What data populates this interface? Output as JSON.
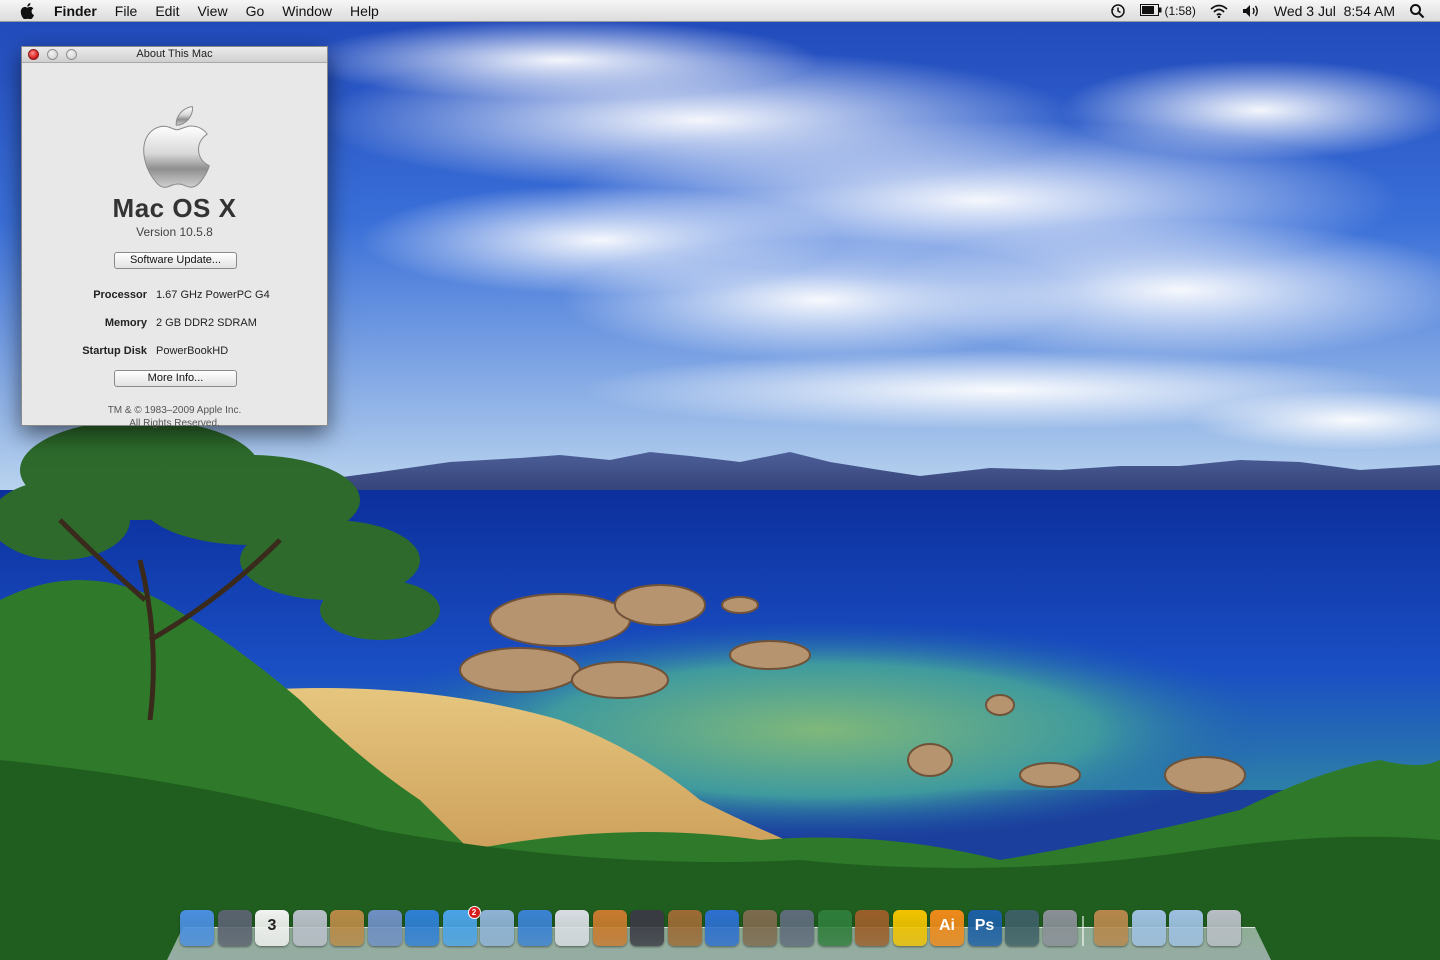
{
  "menubar": {
    "app_name": "Finder",
    "items": [
      "File",
      "Edit",
      "View",
      "Go",
      "Window",
      "Help"
    ],
    "battery_time": "(1:58)",
    "clock": "Wed 3 Jul  8:54 AM"
  },
  "about_window": {
    "title": "About This Mac",
    "os_name": "Mac OS X",
    "version": "Version 10.5.8",
    "software_update_button": "Software Update...",
    "specs": {
      "processor_label": "Processor",
      "processor_value": "1.67 GHz PowerPC G4",
      "memory_label": "Memory",
      "memory_value": "2 GB DDR2 SDRAM",
      "disk_label": "Startup Disk",
      "disk_value": "PowerBookHD"
    },
    "more_info_button": "More Info...",
    "copyright_line1": "TM & © 1983–2009 Apple Inc.",
    "copyright_line2": "All Rights Reserved."
  },
  "dock": {
    "calendar_date": "3",
    "ichat_badge": "2",
    "illustrator_label": "Ai",
    "photoshop_label": "Ps",
    "items": [
      {
        "name": "finder-icon",
        "color": "#4a8ee0"
      },
      {
        "name": "dashboard-icon",
        "color": "#5a6270"
      },
      {
        "name": "ical-icon",
        "color": "#f2f2f2"
      },
      {
        "name": "preview-icon",
        "color": "#b9bfc9"
      },
      {
        "name": "address-book-icon",
        "color": "#b88946"
      },
      {
        "name": "mail-icon",
        "color": "#6f8fc4"
      },
      {
        "name": "safari-icon",
        "color": "#2f7fd6"
      },
      {
        "name": "ichat-icon",
        "color": "#4aa3e8"
      },
      {
        "name": "iphoto-icon",
        "color": "#8fb2d6"
      },
      {
        "name": "itunes-icon",
        "color": "#3b82d4"
      },
      {
        "name": "textedit-icon",
        "color": "#d9dde4"
      },
      {
        "name": "image-capture-icon",
        "color": "#c97a2e"
      },
      {
        "name": "imovie-icon",
        "color": "#3a3a44"
      },
      {
        "name": "garageband-icon",
        "color": "#9c6a35"
      },
      {
        "name": "dvd-player-icon",
        "color": "#2c6fcf"
      },
      {
        "name": "iweb-icon",
        "color": "#7e6a4e"
      },
      {
        "name": "script-editor-icon",
        "color": "#5f6b7b"
      },
      {
        "name": "numbers-icon",
        "color": "#2f7d3b"
      },
      {
        "name": "keynote-icon",
        "color": "#9b5e2a"
      },
      {
        "name": "aim-icon",
        "color": "#f2c300"
      },
      {
        "name": "illustrator-icon",
        "color": "#f08a1a"
      },
      {
        "name": "photoshop-icon",
        "color": "#1c5fa5"
      },
      {
        "name": "time-machine-icon",
        "color": "#3d5f66"
      },
      {
        "name": "system-preferences-icon",
        "color": "#8a8f97"
      },
      {
        "name": "applications-folder-icon",
        "color": "#b7874c"
      },
      {
        "name": "documents-folder-icon",
        "color": "#9fc0e2"
      },
      {
        "name": "downloads-folder-icon",
        "color": "#9fc0e2"
      },
      {
        "name": "trash-icon",
        "color": "#b9bec5"
      }
    ]
  }
}
